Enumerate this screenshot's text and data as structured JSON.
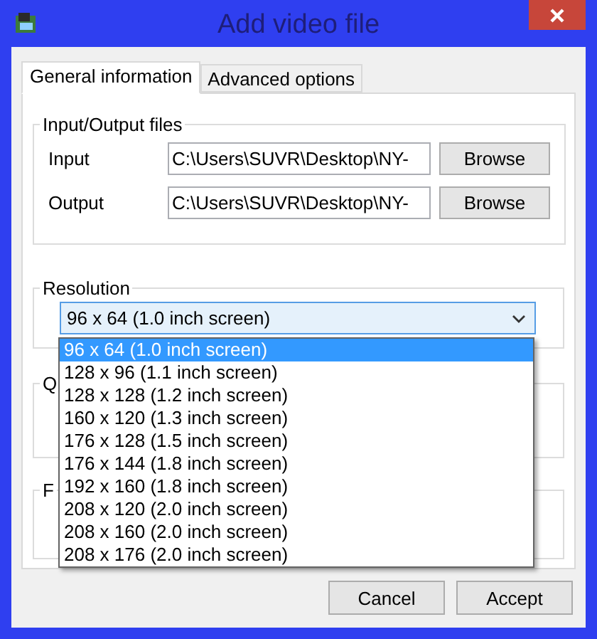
{
  "window": {
    "title": "Add video file"
  },
  "tabs": [
    {
      "label": "General information",
      "selected": true
    },
    {
      "label": "Advanced options",
      "selected": false
    }
  ],
  "io_group": {
    "title": "Input/Output files",
    "rows": [
      {
        "label": "Input",
        "value": "C:\\Users\\SUVR\\Desktop\\NY-",
        "button": "Browse"
      },
      {
        "label": "Output",
        "value": "C:\\Users\\SUVR\\Desktop\\NY-",
        "button": "Browse"
      }
    ]
  },
  "resolution": {
    "title": "Resolution",
    "value": "96 x 64 (1.0 inch screen)",
    "expanded": true,
    "options": [
      {
        "label": "96 x 64 (1.0 inch screen)",
        "selected": true
      },
      {
        "label": "128 x 96 (1.1 inch screen)",
        "selected": false
      },
      {
        "label": "128 x 128 (1.2 inch screen)",
        "selected": false
      },
      {
        "label": "160 x 120 (1.3 inch screen)",
        "selected": false
      },
      {
        "label": "176 x 128 (1.5 inch screen)",
        "selected": false
      },
      {
        "label": "176 x 144 (1.8 inch screen)",
        "selected": false
      },
      {
        "label": "192 x 160 (1.8 inch screen)",
        "selected": false
      },
      {
        "label": "208 x 120 (2.0 inch screen)",
        "selected": false
      },
      {
        "label": "208 x 160 (2.0 inch screen)",
        "selected": false
      },
      {
        "label": "208 x 176 (2.0 inch screen)",
        "selected": false
      }
    ]
  },
  "group_3": {
    "title": "Q"
  },
  "group_4": {
    "title": "F"
  },
  "buttons": [
    "Cancel",
    "Accept"
  ]
}
